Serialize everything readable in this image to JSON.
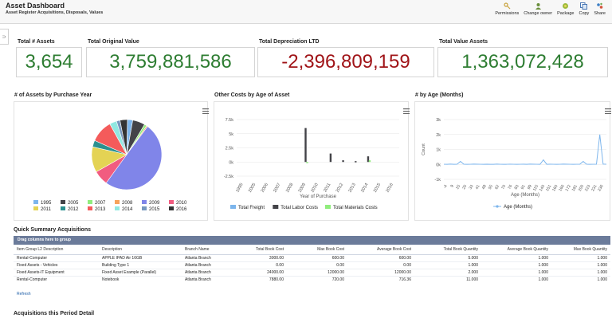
{
  "header": {
    "title": "Asset Dashboard",
    "subtitle": "Asset Register Acquisitions, Disposals, Values",
    "tools": [
      {
        "label": "Permissions",
        "icon": "key-icon"
      },
      {
        "label": "Change owner",
        "icon": "user-icon"
      },
      {
        "label": "Package",
        "icon": "package-icon"
      },
      {
        "label": "Copy",
        "icon": "copy-icon"
      },
      {
        "label": "Share",
        "icon": "share-icon"
      }
    ]
  },
  "sidebar_toggle": "⊃",
  "kpis": [
    {
      "label": "Total # Assets",
      "value": "3,654"
    },
    {
      "label": "Total Original Value",
      "value": "3,759,881,586"
    },
    {
      "label": "Total Depreciation LTD",
      "value": "-2,396,809,159"
    },
    {
      "label": "Total Value Assets",
      "value": "1,363,072,428"
    }
  ],
  "panels": {
    "pie_title": "# of Assets by Purchase Year",
    "costs_title": "Other Costs by Age of Asset",
    "age_title": "# by Age (Months)"
  },
  "chart_data": [
    {
      "type": "pie",
      "title": "# of Assets by Purchase Year",
      "categories": [
        "1995",
        "2005",
        "2007",
        "2008",
        "2009",
        "2010",
        "2011",
        "2012",
        "2013",
        "2014",
        "2015",
        "2016"
      ],
      "values": [
        90,
        210,
        40,
        20,
        1820,
        250,
        430,
        110,
        380,
        120,
        60,
        124
      ],
      "colors": [
        "#7cb5ec",
        "#434348",
        "#90ed7d",
        "#f7a35c",
        "#8085e9",
        "#f15c80",
        "#e4d354",
        "#2b908f",
        "#f45b5b",
        "#91e8e1",
        "#7798bf",
        "#333333"
      ]
    },
    {
      "type": "bar",
      "title": "Other Costs by Age of Asset",
      "xlabel": "Year of Purchase",
      "categories": [
        "1995",
        "2005",
        "2006",
        "2007",
        "2008",
        "2009",
        "2010",
        "2011",
        "2012",
        "2013",
        "2014",
        "2015",
        "2016"
      ],
      "ylim": [
        -2500,
        7500
      ],
      "yticks": [
        "7.5k",
        "5k",
        "2.5k",
        "0k",
        "-2.5k"
      ],
      "ytick_values": [
        7500,
        5000,
        2500,
        0,
        -2500
      ],
      "series": [
        {
          "name": "Total Freight",
          "color": "#7cb5ec",
          "values": [
            0,
            0,
            0,
            0,
            0,
            0,
            0,
            0,
            0,
            0,
            0,
            0,
            0
          ]
        },
        {
          "name": "Total Labor Costs",
          "color": "#434348",
          "values": [
            0,
            0,
            0,
            0,
            0,
            6000,
            0,
            1500,
            300,
            150,
            1000,
            0,
            0
          ]
        },
        {
          "name": "Total Materials Costs",
          "color": "#90ed7d",
          "values": [
            0,
            0,
            0,
            0,
            0,
            -200,
            0,
            0,
            0,
            0,
            300,
            0,
            0
          ]
        }
      ]
    },
    {
      "type": "line",
      "title": "# by Age (Months)",
      "xlabel": "Age (Months)",
      "ylabel": "Count",
      "ylim": [
        -1000,
        3000
      ],
      "yticks": [
        "3k",
        "2k",
        "1k",
        "0k",
        "-1k"
      ],
      "ytick_values": [
        3000,
        2000,
        1000,
        0,
        -1000
      ],
      "x_tick_labels": [
        "-4",
        "9",
        "15",
        "25",
        "33",
        "41",
        "48",
        "55",
        "62",
        "70",
        "76",
        "83",
        "91",
        "99",
        "115",
        "140",
        "151",
        "160",
        "166",
        "172",
        "181",
        "200",
        "223",
        "231",
        "236"
      ],
      "series": [
        {
          "name": "Age (Months)",
          "color": "#7cb5ec",
          "values": [
            10,
            5,
            20,
            10,
            15,
            200,
            10,
            5,
            10,
            20,
            15,
            10,
            5,
            15,
            10,
            10,
            20,
            10,
            5,
            10,
            15,
            10,
            5,
            10,
            15,
            10,
            20,
            15,
            10,
            5,
            300,
            10,
            15,
            10,
            5,
            10,
            20,
            15,
            10,
            5,
            10,
            15,
            200,
            10,
            5,
            10,
            15,
            2000,
            20,
            10
          ]
        }
      ]
    }
  ],
  "summary": {
    "title": "Quick Summary Acquisitions",
    "group_hint": "Drag columns here to group",
    "columns": [
      "Item Group L2 Description",
      "Description",
      "Branch Name",
      "Total Book Cost",
      "Max Book Cost",
      "Average Book Cost",
      "Total Book Quantity",
      "Average Book Quantity",
      "Max Book Quantity"
    ],
    "rows": [
      [
        "Rental-Computer",
        "APPLE IPAD Air 16GB",
        "Atlanta Branch",
        "3000.00",
        "600.00",
        "600.00",
        "5.000",
        "1.000",
        "1.000"
      ],
      [
        "Fixed Assets - Vehicles",
        "Building Type 1",
        "Atlanta Branch",
        "0.00",
        "0.00",
        "0.00",
        "1.000",
        "1.000",
        "1.000"
      ],
      [
        "Fixed Assets-IT Equipment",
        "Fixed Asset Example (Parallel)",
        "Atlanta Branch",
        "24000.00",
        "12000.00",
        "12000.00",
        "2.000",
        "1.000",
        "1.000"
      ],
      [
        "Rental-Computer",
        "Notebook",
        "Atlanta Branch",
        "7880.00",
        "720.00",
        "716.36",
        "11.000",
        "1.000",
        "1.000"
      ]
    ],
    "refresh_label": "Refresh"
  },
  "detail": {
    "title": "Acquisitions this Period Detail"
  }
}
